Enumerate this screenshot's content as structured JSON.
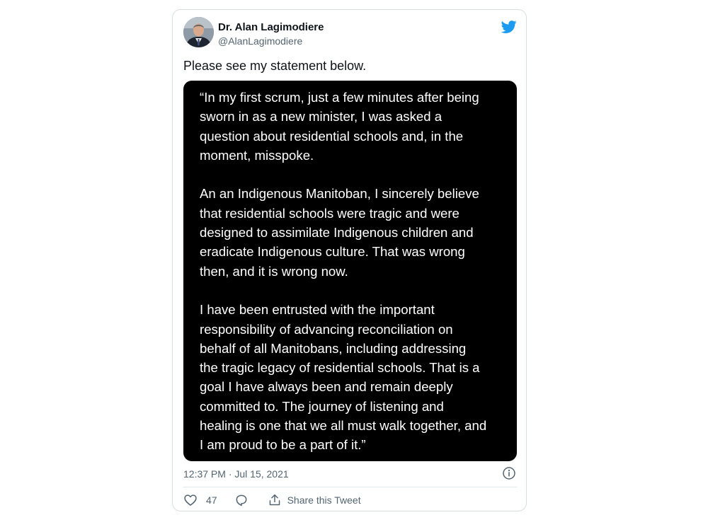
{
  "author": {
    "name": "Dr. Alan Lagimodiere",
    "handle": "@AlanLagimodiere",
    "avatar": "profile-photo"
  },
  "tweet": {
    "text": "Please see my statement below.",
    "statement_paragraphs": [
      "“In my first scrum, just a few minutes after being\nsworn in as a new minister, I was asked a\nquestion about residential schools and, in the\nmoment, misspoke.",
      "An an Indigenous Manitoban, I sincerely believe\nthat residential schools were tragic and were\ndesigned to assimilate Indigenous children and\neradicate Indigenous culture. That was wrong\nthen, and it is wrong now.",
      "I have been entrusted with the important\nresponsibility of advancing reconciliation on\nbehalf of all Manitobans, including addressing\nthe tragic legacy of residential schools. That is a\ngoal I have always been and remain deeply\ncommitted to. The journey of listening and\nhealing is one that we all must walk together, and\nI am proud to be a part of it.”"
    ],
    "timestamp": "12:37 PM · Jul 15, 2021"
  },
  "actions": {
    "like_count": "47",
    "share_label": "Share this Tweet"
  },
  "icons": {
    "brand": "twitter-bird-icon",
    "info": "info-icon",
    "like": "heart-icon",
    "reply": "reply-bubble-icon",
    "share": "share-upload-icon"
  },
  "colors": {
    "brand": "#1d9bf0",
    "text": "#0f1419",
    "secondary_text": "#536471",
    "statement_background": "#000000",
    "border": "#d7dde2"
  }
}
